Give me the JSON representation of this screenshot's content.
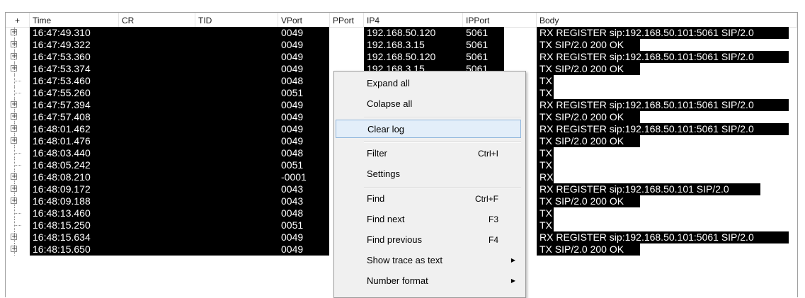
{
  "columns": [
    "+",
    "Time",
    "CR",
    "TID",
    "VPort",
    "PPort",
    "IP4",
    "IPPort",
    "Body"
  ],
  "rows": [
    {
      "expand": true,
      "time": "16:47:49.310",
      "vport": "0049",
      "ip4": "192.168.50.120",
      "ipport": "5061",
      "body": "RX REGISTER sip:192.168.50.101:5061 SIP/2.0"
    },
    {
      "expand": true,
      "time": "16:47:49.322",
      "vport": "0049",
      "ip4": "192.168.3.15",
      "ipport": "5061",
      "body": "TX SIP/2.0 200 OK"
    },
    {
      "expand": true,
      "time": "16:47:53.360",
      "vport": "0049",
      "ip4": "192.168.50.120",
      "ipport": "5061",
      "body": "RX REGISTER sip:192.168.50.101:5061 SIP/2.0"
    },
    {
      "expand": true,
      "time": "16:47:53.374",
      "vport": "0049",
      "ip4": "192.168.3.15",
      "ipport": "5061",
      "body": "TX SIP/2.0 200 OK"
    },
    {
      "expand": false,
      "time": "16:47:53.460",
      "vport": "0048",
      "ip4": "",
      "ipport": "",
      "body": "TX"
    },
    {
      "expand": false,
      "time": "16:47:55.260",
      "vport": "0051",
      "ip4": "",
      "ipport": "",
      "body": "TX"
    },
    {
      "expand": true,
      "time": "16:47:57.394",
      "vport": "0049",
      "ip4": "",
      "ipport": "",
      "body": "RX REGISTER sip:192.168.50.101:5061 SIP/2.0"
    },
    {
      "expand": true,
      "time": "16:47:57.408",
      "vport": "0049",
      "ip4": "",
      "ipport": "",
      "body": "TX SIP/2.0 200 OK"
    },
    {
      "expand": true,
      "time": "16:48:01.462",
      "vport": "0049",
      "ip4": "",
      "ipport": "",
      "body": "RX REGISTER sip:192.168.50.101:5061 SIP/2.0"
    },
    {
      "expand": true,
      "time": "16:48:01.476",
      "vport": "0049",
      "ip4": "",
      "ipport": "",
      "body": "TX SIP/2.0 200 OK"
    },
    {
      "expand": false,
      "time": "16:48:03.440",
      "vport": "0048",
      "ip4": "",
      "ipport": "",
      "body": "TX"
    },
    {
      "expand": false,
      "time": "16:48:05.242",
      "vport": "0051",
      "ip4": "",
      "ipport": "",
      "body": "TX"
    },
    {
      "expand": true,
      "time": "16:48:08.210",
      "vport": "-0001",
      "ip4": "",
      "ipport": "",
      "body": "RX"
    },
    {
      "expand": true,
      "time": "16:48:09.172",
      "vport": "0043",
      "ip4": "",
      "ipport": "",
      "body": "RX REGISTER sip:192.168.50.101 SIP/2.0"
    },
    {
      "expand": true,
      "time": "16:48:09.188",
      "vport": "0043",
      "ip4": "",
      "ipport": "",
      "body": "TX SIP/2.0 200 OK"
    },
    {
      "expand": false,
      "time": "16:48:13.460",
      "vport": "0048",
      "ip4": "",
      "ipport": "",
      "body": "TX"
    },
    {
      "expand": false,
      "time": "16:48:15.250",
      "vport": "0051",
      "ip4": "",
      "ipport": "",
      "body": "TX"
    },
    {
      "expand": true,
      "time": "16:48:15.634",
      "vport": "0049",
      "ip4": "",
      "ipport": "",
      "body": "RX REGISTER sip:192.168.50.101:5061 SIP/2.0"
    },
    {
      "expand": true,
      "time": "16:48:15.650",
      "vport": "0049",
      "ip4": "",
      "ipport": "",
      "body": "TX SIP/2.0 200 OK"
    }
  ],
  "context_menu": {
    "items": [
      {
        "label": "Expand all",
        "shortcut": "",
        "submenu": false,
        "highlighted": false
      },
      {
        "label": "Colapse all",
        "shortcut": "",
        "submenu": false,
        "highlighted": false
      },
      {
        "separator": true
      },
      {
        "label": "Clear log",
        "shortcut": "",
        "submenu": false,
        "highlighted": true
      },
      {
        "separator": true
      },
      {
        "label": "Filter",
        "shortcut": "Ctrl+I",
        "submenu": false,
        "highlighted": false
      },
      {
        "label": "Settings",
        "shortcut": "",
        "submenu": false,
        "highlighted": false
      },
      {
        "separator": true
      },
      {
        "label": "Find",
        "shortcut": "Ctrl+F",
        "submenu": false,
        "highlighted": false
      },
      {
        "label": "Find next",
        "shortcut": "F3",
        "submenu": false,
        "highlighted": false
      },
      {
        "label": "Find previous",
        "shortcut": "F4",
        "submenu": false,
        "highlighted": false
      },
      {
        "label": "Show trace as text",
        "shortcut": "",
        "submenu": true,
        "highlighted": false
      },
      {
        "label": "Number format",
        "shortcut": "",
        "submenu": true,
        "highlighted": false
      }
    ]
  },
  "colors": {
    "highlight_bg": "#000000",
    "highlight_text": "#ffffff",
    "menu_bg": "#f0f0f0",
    "menu_hover": "#e3eef9"
  }
}
